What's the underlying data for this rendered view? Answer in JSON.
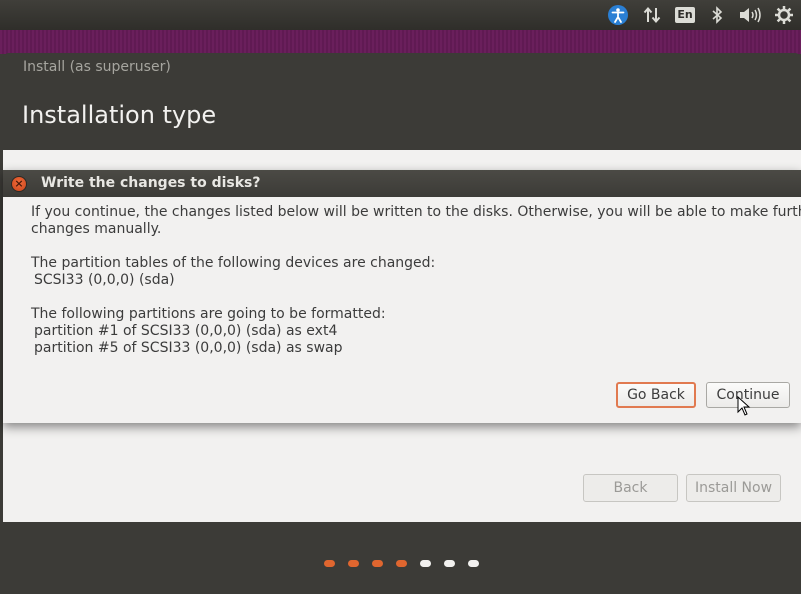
{
  "panel": {
    "keyboard_layout": "En",
    "icons": [
      "accessibility-icon",
      "network-icon",
      "bluetooth-icon",
      "volume-icon",
      "session-icon"
    ]
  },
  "window": {
    "title": "Install (as superuser)",
    "page_title": "Installation type",
    "back_label": "Back",
    "install_now_label": "Install Now"
  },
  "dialog": {
    "title": "Write the changes to disks?",
    "intro_line1": "If you continue, the changes listed below will be written to the disks. Otherwise, you will be able to make further",
    "intro_line2": "changes manually.",
    "partition_tables_heading": "The partition tables of the following devices are changed:",
    "partition_tables": [
      "SCSI33 (0,0,0) (sda)"
    ],
    "format_heading": "The following partitions are going to be formatted:",
    "format_items": [
      "partition #1 of SCSI33 (0,0,0) (sda) as ext4",
      "partition #5 of SCSI33 (0,0,0) (sda) as swap"
    ],
    "go_back_label": "Go Back",
    "continue_label": "Continue"
  },
  "progress": {
    "total_steps": 7,
    "completed_steps": 4,
    "active_color": "#e0662f",
    "inactive_color": "#f2f1ef"
  },
  "colors": {
    "accent": "#e0662f",
    "panel": "#3c3b37",
    "purple": "#6a1f5c"
  }
}
